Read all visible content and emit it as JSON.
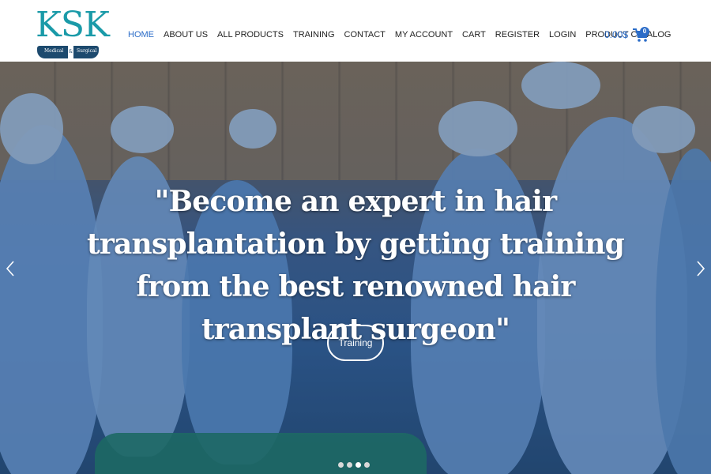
{
  "logo": {
    "text": "KSK",
    "tag_left": "Medical",
    "tag_amp": "&",
    "tag_right": "Surgical"
  },
  "nav": {
    "items": [
      {
        "label": "HOME",
        "active": true
      },
      {
        "label": "ABOUT US"
      },
      {
        "label": "ALL PRODUCTS"
      },
      {
        "label": "TRAINING"
      },
      {
        "label": "CONTACT"
      },
      {
        "label": "MY ACCOUNT"
      },
      {
        "label": "CART"
      },
      {
        "label": "REGISTER"
      },
      {
        "label": "LOGIN"
      },
      {
        "label": "PRODUCT CATALOG"
      }
    ]
  },
  "cart": {
    "total": "0.00$",
    "count": "0",
    "icon": "cart-icon"
  },
  "hero": {
    "headline": "\"Become an expert in hair transplantation by getting training from the best renowned hair transplant surgeon\"",
    "button_label": "Training",
    "slides": 4,
    "active_slide": 3,
    "prev_icon": "chevron-left-icon",
    "next_icon": "chevron-right-icon"
  },
  "colors": {
    "accent": "#2b6cc8",
    "logo_teal": "#1a9aa8",
    "logo_navy": "#1d4a6e"
  }
}
